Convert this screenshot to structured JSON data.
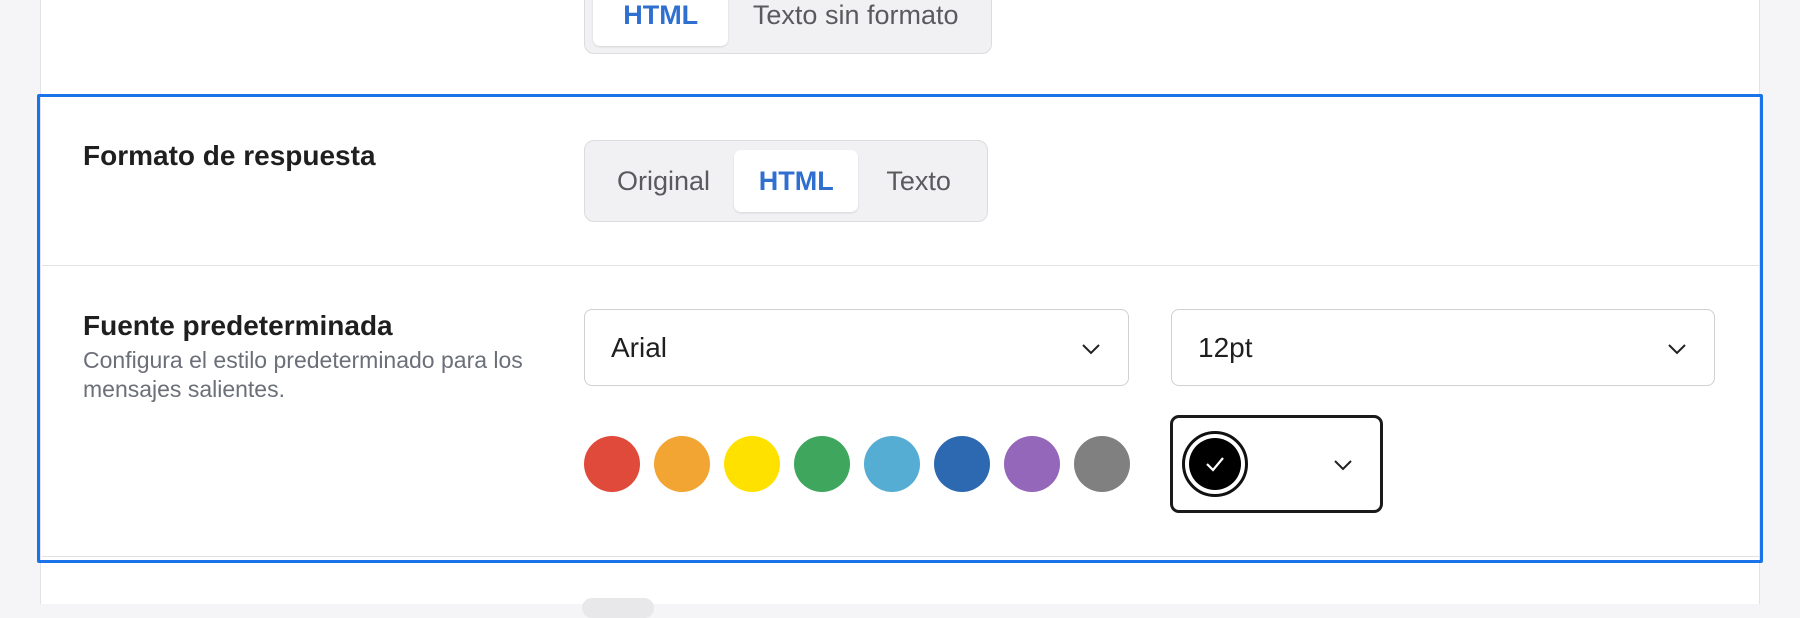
{
  "top_format": {
    "options": [
      "HTML",
      "Texto sin formato"
    ],
    "selected": "HTML"
  },
  "reply_format": {
    "title": "Formato de respuesta",
    "options": [
      "Original",
      "HTML",
      "Texto"
    ],
    "selected": "HTML"
  },
  "default_font": {
    "title": "Fuente predeterminada",
    "description": "Configura el estilo predeterminado para los mensajes salientes.",
    "font_family_value": "Arial",
    "font_size_value": "12pt",
    "swatches": [
      {
        "name": "red",
        "hex": "#e04a3a"
      },
      {
        "name": "orange",
        "hex": "#f2a533"
      },
      {
        "name": "yellow",
        "hex": "#ffe100"
      },
      {
        "name": "green",
        "hex": "#3fa65e"
      },
      {
        "name": "light-blue",
        "hex": "#55add4"
      },
      {
        "name": "blue",
        "hex": "#2d69b0"
      },
      {
        "name": "purple",
        "hex": "#9467bb"
      },
      {
        "name": "gray",
        "hex": "#808080"
      }
    ],
    "selected_color": "#000000"
  },
  "colors": {
    "accent": "#1a73e8",
    "active_text": "#2f6fd0"
  }
}
